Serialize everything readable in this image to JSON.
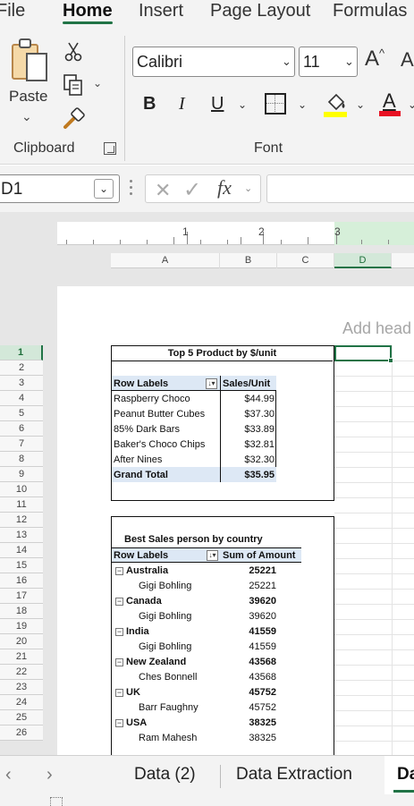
{
  "menu": {
    "tabs": [
      "File",
      "Home",
      "Insert",
      "Page Layout",
      "Formulas"
    ],
    "active": "Home"
  },
  "ribbon": {
    "paste_label": "Paste",
    "clipboard_label": "Clipboard",
    "font_label": "Font",
    "font_name": "Calibri",
    "font_size": "11",
    "bold": "B",
    "italic": "I",
    "underline": "U",
    "grow": "A",
    "shrink": "A",
    "font_color_letter": "A",
    "font_color": "#e81123",
    "highlight_color": "#ffff00",
    "accent": "#217346"
  },
  "formula_bar": {
    "name_box": "D1",
    "fx": "fx",
    "formula": ""
  },
  "sheet": {
    "ruler": [
      "1",
      "2",
      "3"
    ],
    "columns": [
      "A",
      "B",
      "C",
      "D"
    ],
    "selected_column": "D",
    "add_header": "Add head",
    "rows": [
      "1",
      "2",
      "3",
      "4",
      "5",
      "6",
      "7",
      "8",
      "9",
      "10",
      "11",
      "12",
      "13",
      "14",
      "15",
      "16",
      "17",
      "18",
      "19",
      "20",
      "21",
      "22",
      "23",
      "24",
      "25",
      "26"
    ],
    "selected_row": "1"
  },
  "pivot1": {
    "title": "Top 5 Product by $/unit",
    "header_labels": "Row Labels",
    "header_value": "Sales/Unit",
    "rows": [
      {
        "label": "Raspberry Choco",
        "value": "$44.99"
      },
      {
        "label": "Peanut Butter Cubes",
        "value": "$37.30"
      },
      {
        "label": "85% Dark Bars",
        "value": "$33.89"
      },
      {
        "label": "Baker's Choco Chips",
        "value": "$32.81"
      },
      {
        "label": "After Nines",
        "value": "$32.30"
      }
    ],
    "total_label": "Grand Total",
    "total_value": "$35.95"
  },
  "pivot2": {
    "title": "Best Sales person by country",
    "header_labels": "Row Labels",
    "header_value": "Sum of Amount",
    "groups": [
      {
        "country": "Australia",
        "total": "25221",
        "person": "Gigi Bohling",
        "amount": "25221"
      },
      {
        "country": "Canada",
        "total": "39620",
        "person": "Gigi Bohling",
        "amount": "39620"
      },
      {
        "country": "India",
        "total": "41559",
        "person": "Gigi Bohling",
        "amount": "41559"
      },
      {
        "country": "New Zealand",
        "total": "43568",
        "person": "Ches Bonnell",
        "amount": "43568"
      },
      {
        "country": "UK",
        "total": "45752",
        "person": "Barr Faughny",
        "amount": "45752"
      },
      {
        "country": "USA",
        "total": "38325",
        "person": "Ram Mahesh",
        "amount": "38325"
      }
    ]
  },
  "sheet_tabs": {
    "tabs": [
      "Data (2)",
      "Data Extraction",
      "Da"
    ],
    "active": "Da"
  }
}
